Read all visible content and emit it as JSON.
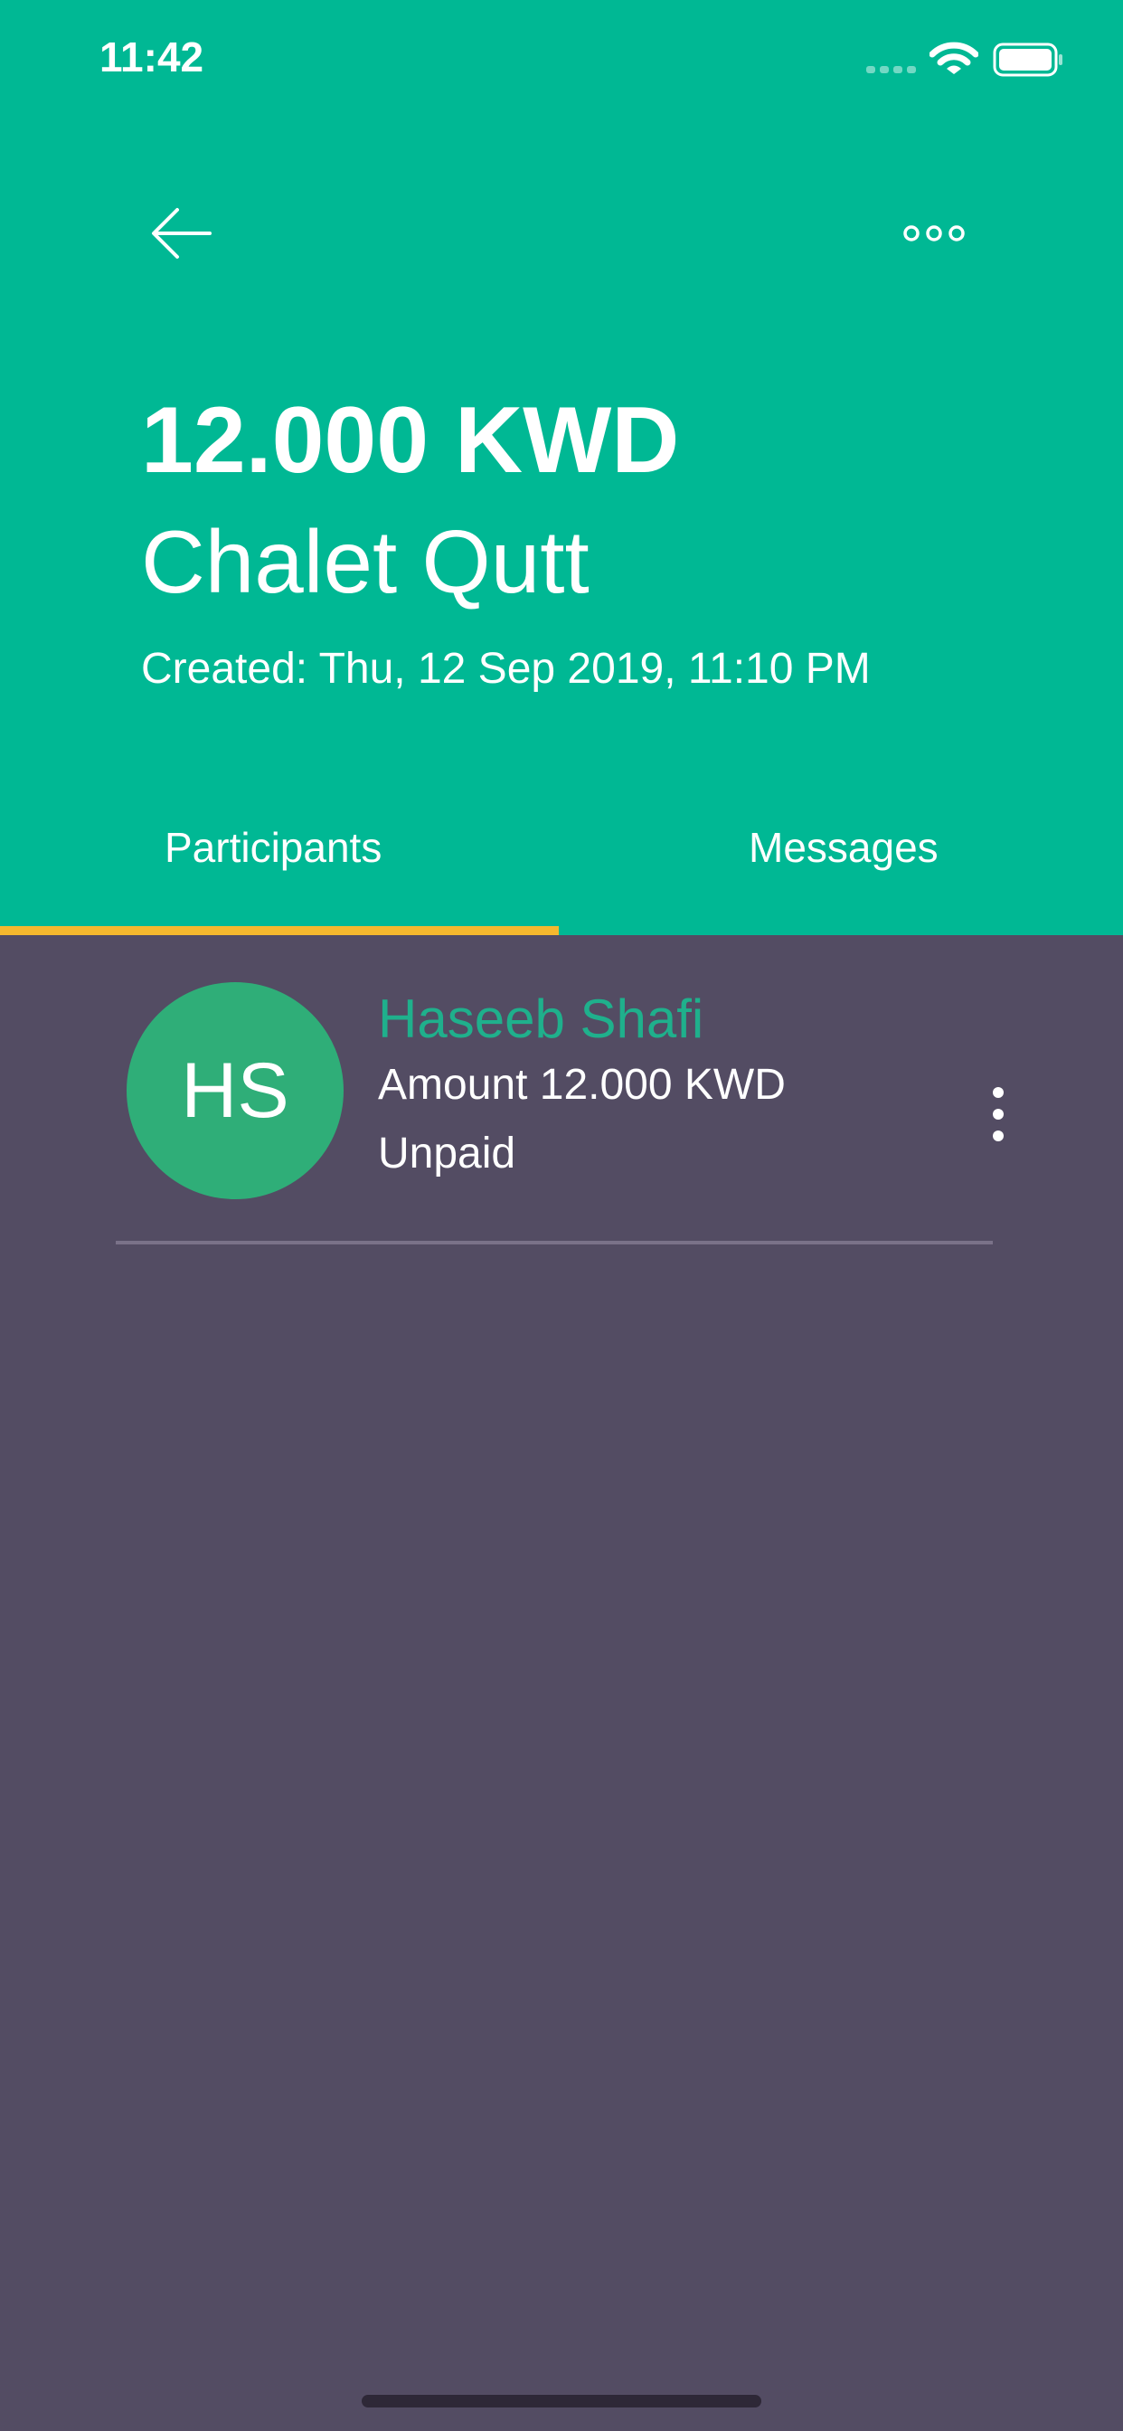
{
  "status_bar": {
    "time": "11:42",
    "icons": [
      "cellular-signal-icon",
      "wifi-icon",
      "battery-icon"
    ]
  },
  "nav": {
    "icons": [
      "back-arrow-icon",
      "more-options-icon"
    ]
  },
  "header": {
    "amount": "12.000 KWD",
    "name": "Chalet Qutt",
    "created": "Created: Thu, 12 Sep 2019, 11:10 PM"
  },
  "tabs": [
    {
      "label": "Participants",
      "active": true
    },
    {
      "label": "Messages",
      "active": false
    }
  ],
  "participants": [
    {
      "initials": "HS",
      "name": "Haseeb Shafi",
      "amount": "Amount 12.000 KWD",
      "status": "Unpaid",
      "icon": "more-vertical-icon"
    }
  ],
  "colors": {
    "header_bg": "#00b894",
    "body_bg": "#534c63",
    "tab_indicator": "#f5b82e",
    "avatar_bg": "#2fae78",
    "participant_name": "#1fb08c"
  }
}
